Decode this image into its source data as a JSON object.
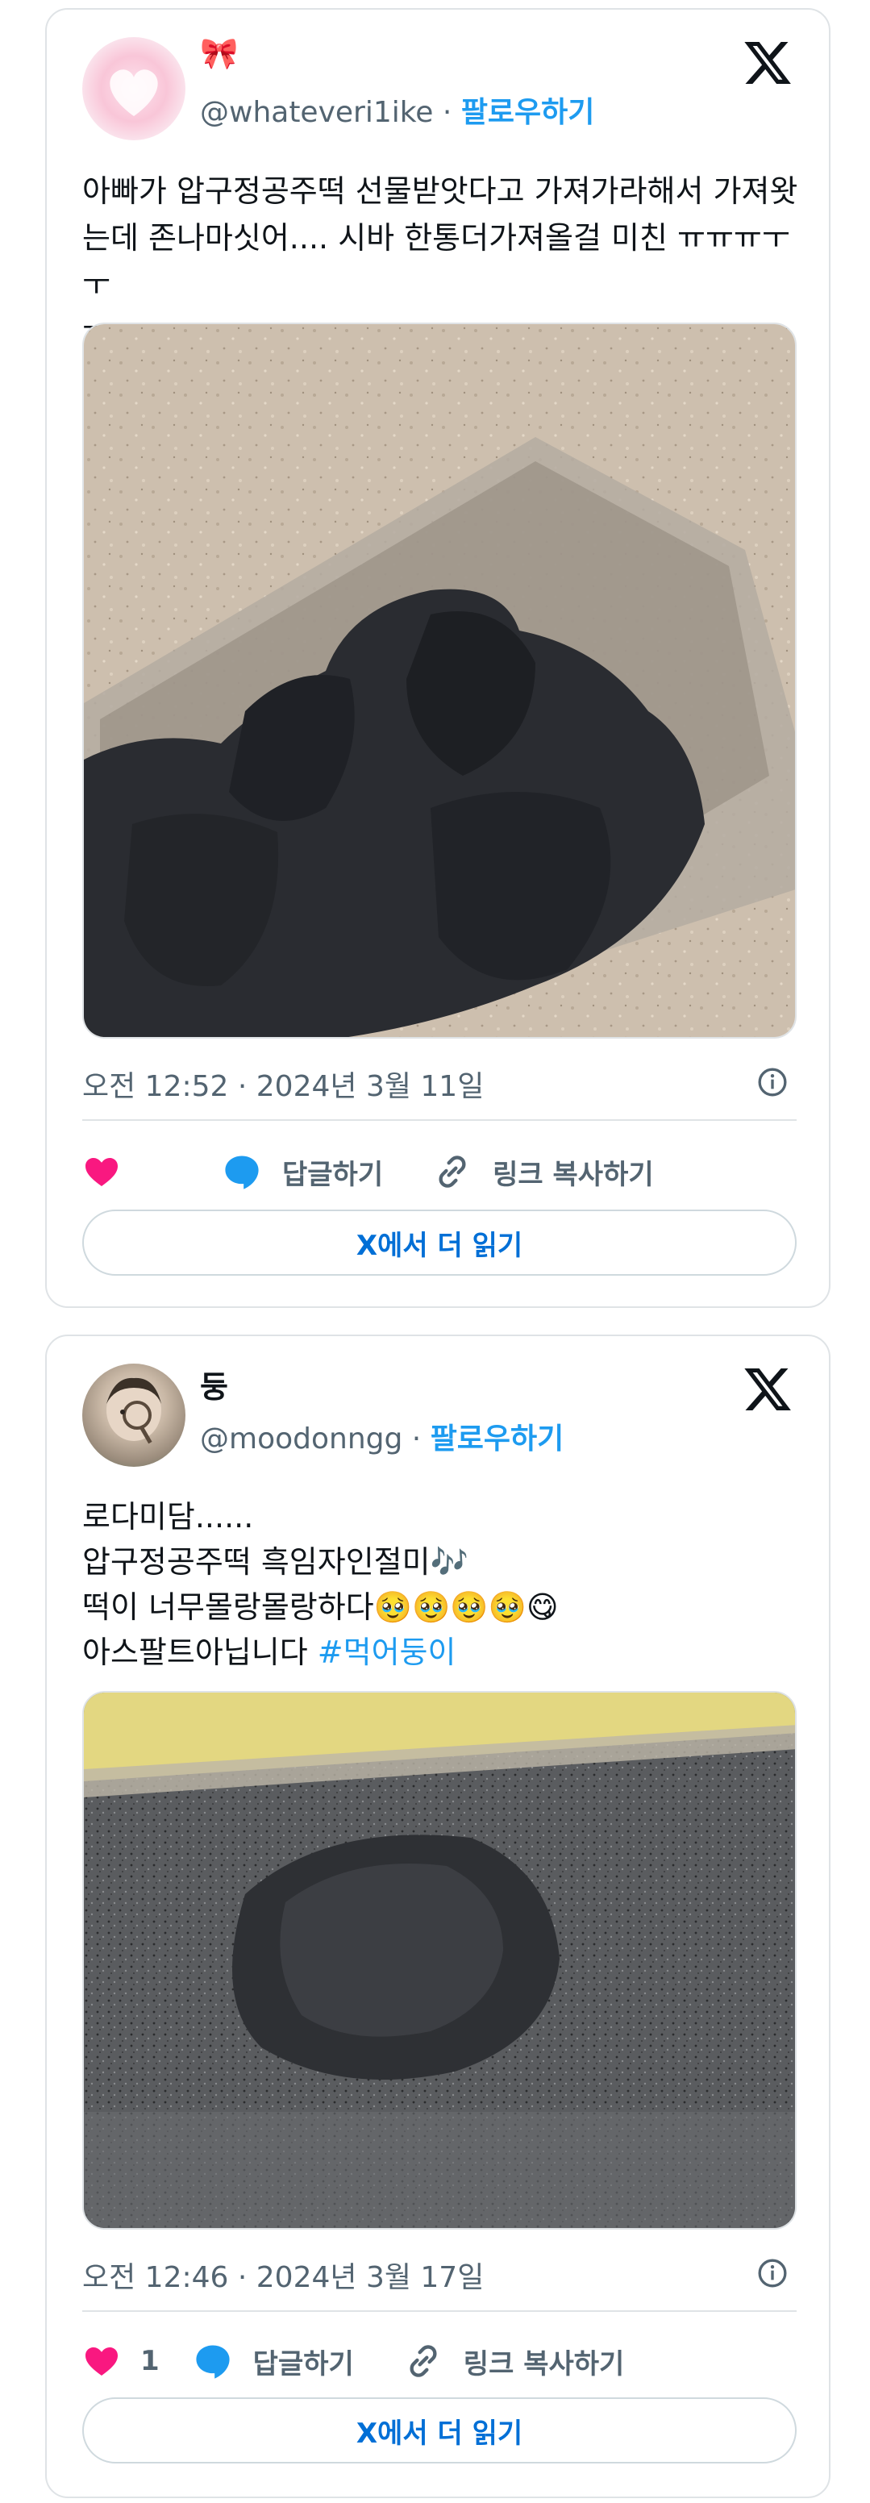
{
  "tweets": [
    {
      "name": "🎀",
      "handle": "@whateveri1ike",
      "follow_label": "팔로우하기",
      "text_lines": [
        "아빠가 압구정공주떡 선물받앗다고 가져가라해서 가져왓",
        "는데 존나마싯어.... 시바 한통더가져올걸 미친 ㅠㅠㅠㅜㅜ",
        "ㅜㅜㅜㅠㅠㅠㅠㅜㅠ"
      ],
      "timestamp": "오전 12:52 · 2024년 3월 11일",
      "like_count": "",
      "reply_label": "답글하기",
      "copy_label": "링크 복사하기",
      "read_more_label": "X에서 더 읽기"
    },
    {
      "name": "둥",
      "handle": "@moodonngg",
      "follow_label": "팔로우하기",
      "line1": "로다미담......",
      "line2": "압구정공주떡 흑임자인절미🎶",
      "line3": "떡이 너무몰랑몰랑하다🥹🥹🥹🥹😋",
      "line4_text": "아스팔트아닙니다 ",
      "line4_hashtag": "#먹어둥이",
      "timestamp": "오전 12:46 · 2024년 3월 17일",
      "like_count": "1",
      "reply_label": "답글하기",
      "copy_label": "링크 복사하기",
      "read_more_label": "X에서 더 읽기"
    }
  ],
  "colors": {
    "like": "#f91880",
    "reply": "#1d9bf0",
    "link": "#006fd6",
    "muted": "#536471"
  },
  "icons": [
    "x-logo-icon",
    "heart-icon",
    "reply-bubble-icon",
    "link-icon",
    "info-icon"
  ]
}
